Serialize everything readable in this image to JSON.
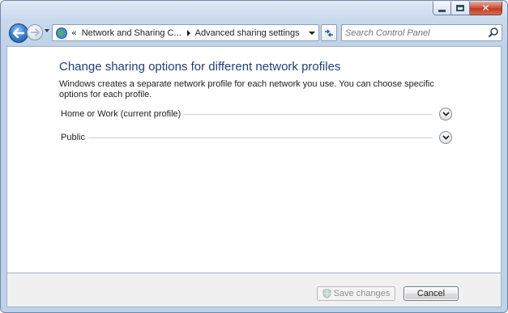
{
  "titlebar": {
    "minimize_icon": "minimize-icon",
    "maximize_icon": "maximize-icon",
    "close_icon": "close-icon",
    "close_glyph": "✕"
  },
  "navigation": {
    "back_icon": "back-arrow-icon",
    "forward_icon": "forward-arrow-icon",
    "address": {
      "overflow_glyph": "«",
      "breadcrumbs": [
        {
          "label": "Network and Sharing C..."
        },
        {
          "label": "Advanced sharing settings"
        }
      ]
    },
    "search": {
      "placeholder": "Search Control Panel"
    }
  },
  "main": {
    "heading": "Change sharing options for different network profiles",
    "description": "Windows creates a separate network profile for each network you use. You can choose specific options for each profile.",
    "profiles": [
      {
        "label": "Home or Work (current profile)",
        "expanded": false
      },
      {
        "label": "Public",
        "expanded": false
      }
    ]
  },
  "footer": {
    "save_label": "Save changes",
    "save_enabled": false,
    "cancel_label": "Cancel"
  },
  "colors": {
    "heading": "#1e3f7a",
    "frame": "#bfd2e8",
    "close_button": "#c03a22"
  }
}
